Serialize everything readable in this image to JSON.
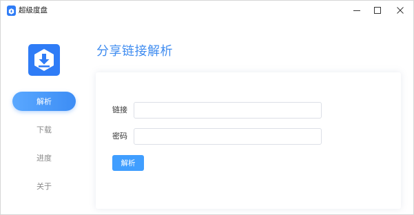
{
  "window": {
    "title": "超级度盘"
  },
  "sidebar": {
    "items": [
      {
        "label": "解析",
        "active": true
      },
      {
        "label": "下载",
        "active": false
      },
      {
        "label": "进度",
        "active": false
      },
      {
        "label": "关于",
        "active": false
      }
    ]
  },
  "main": {
    "title": "分享链接解析",
    "form": {
      "link_label": "链接",
      "link_value": "",
      "password_label": "密码",
      "password_value": "",
      "submit_label": "解析"
    }
  },
  "colors": {
    "accent": "#409eff",
    "title_blue": "#3f8cf0",
    "logo_blue": "#2f7cf6"
  },
  "icons": [
    "app-logo-icon",
    "download-shield-icon",
    "minimize-icon",
    "maximize-icon",
    "close-icon"
  ]
}
